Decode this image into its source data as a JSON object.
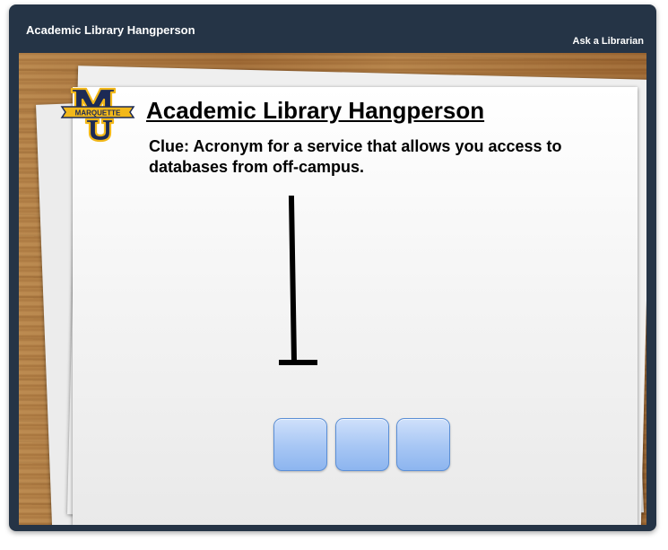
{
  "header": {
    "title": "Academic Library Hangperson",
    "ask_librarian": "Ask a Librarian"
  },
  "logo": {
    "text": "MARQUETTE",
    "icon": "mu-logo"
  },
  "game": {
    "title": "Academic Library Hangperson",
    "clue": "Clue: Acronym for a service that allows you access to databases from off-campus.",
    "letter_boxes": [
      "",
      "",
      ""
    ]
  },
  "colors": {
    "header_bg": "#253446",
    "letter_box": "#a6c6f4",
    "logo_gold": "#f2b81a",
    "logo_navy": "#1c2a55"
  }
}
